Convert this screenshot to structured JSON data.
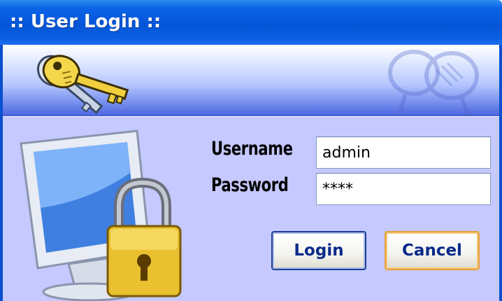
{
  "window": {
    "title": ":: User Login ::"
  },
  "form": {
    "username_label": "Username",
    "username_value": "admin",
    "password_label": "Password",
    "password_value": "****"
  },
  "buttons": {
    "login_label": "Login",
    "cancel_label": "Cancel"
  },
  "icons": {
    "banner_left": "keys-icon",
    "banner_right": "keys-watermark-icon",
    "main": "monitor-lock-icon"
  },
  "colors": {
    "titlebar": "#0555d8",
    "panel": "#c5c9ff",
    "button_text": "#0a2a8a",
    "focus_border": "#e8a13a"
  }
}
